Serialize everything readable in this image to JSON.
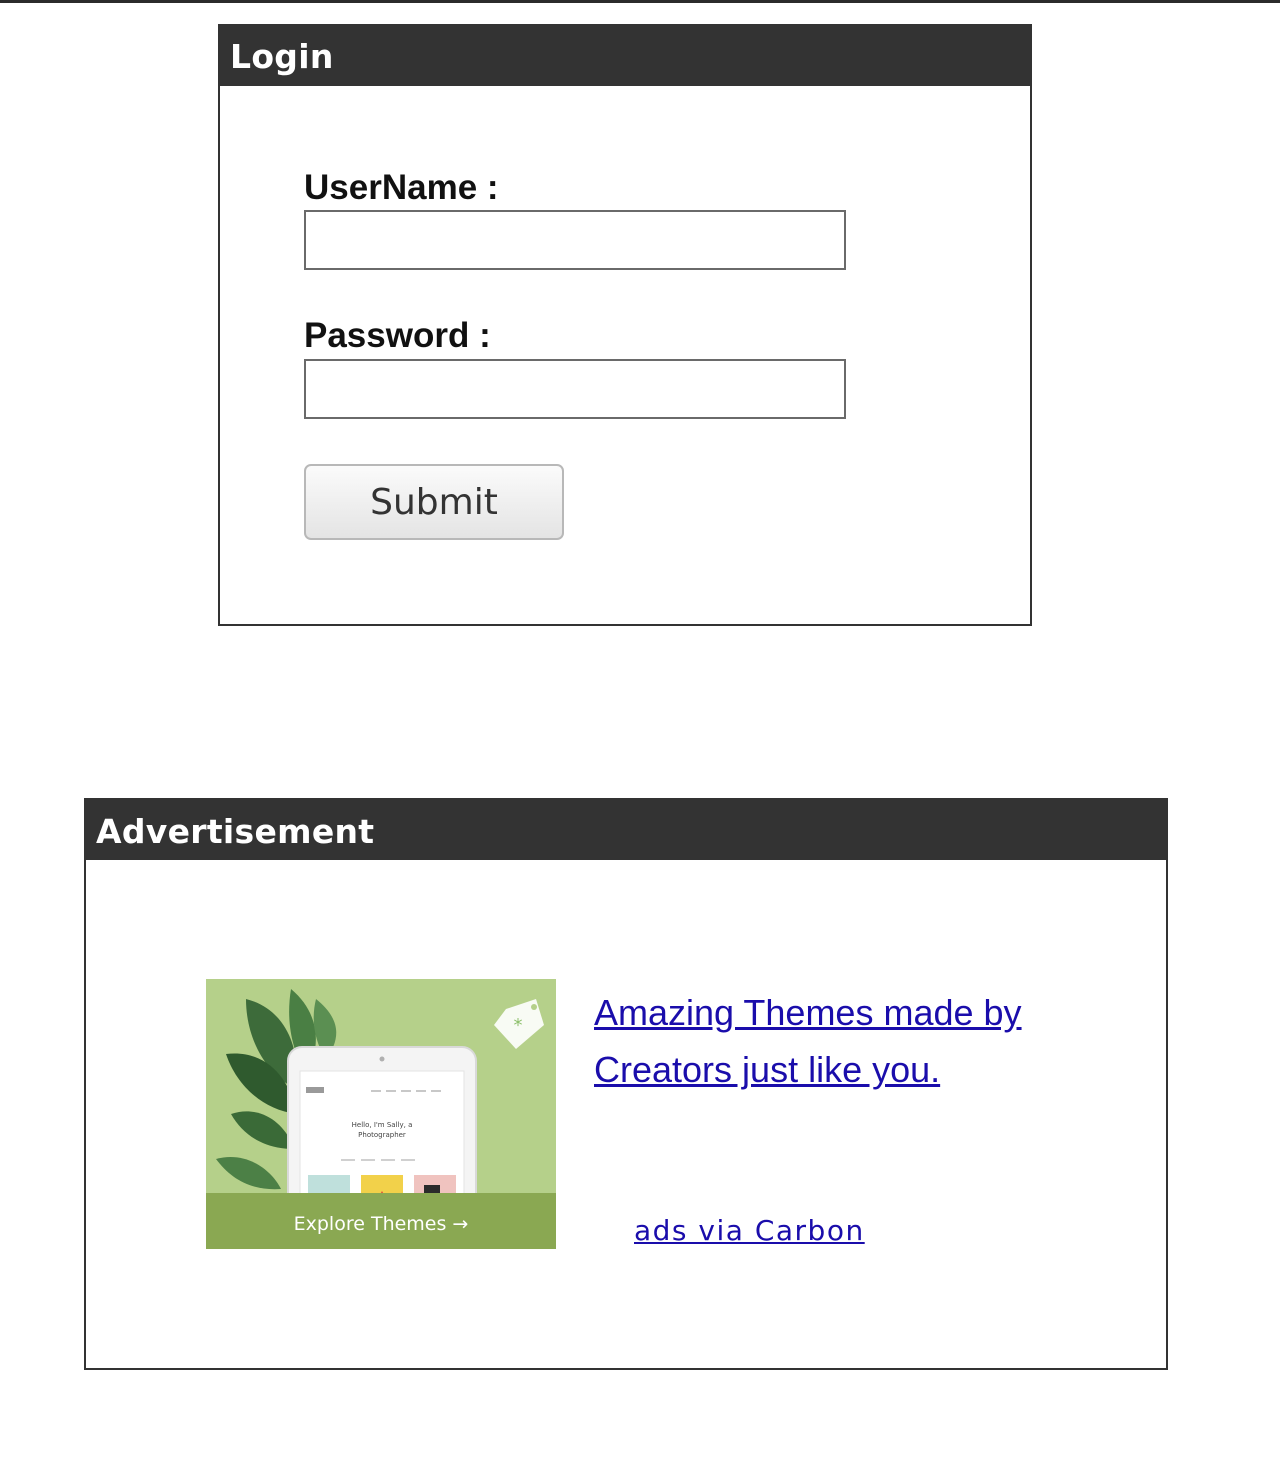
{
  "login": {
    "title": "Login",
    "username_label": "UserName :",
    "username_value": "",
    "password_label": "Password :",
    "password_value": "",
    "submit_label": "Submit"
  },
  "advertisement": {
    "title": "Advertisement",
    "image": {
      "cta_label": "Explore Themes →",
      "device_greeting_line1": "Hello, I'm Sally, a",
      "device_greeting_line2": "Photographer",
      "device_logo": "Sally"
    },
    "link_text": "Amazing Themes made by Creators just like you.",
    "via_text": "ads via Carbon"
  },
  "colors": {
    "header_bg": "#333333",
    "link": "#1a0dab",
    "ad_green": "#b5d08a",
    "ad_cta_bar": "#8aa852"
  }
}
